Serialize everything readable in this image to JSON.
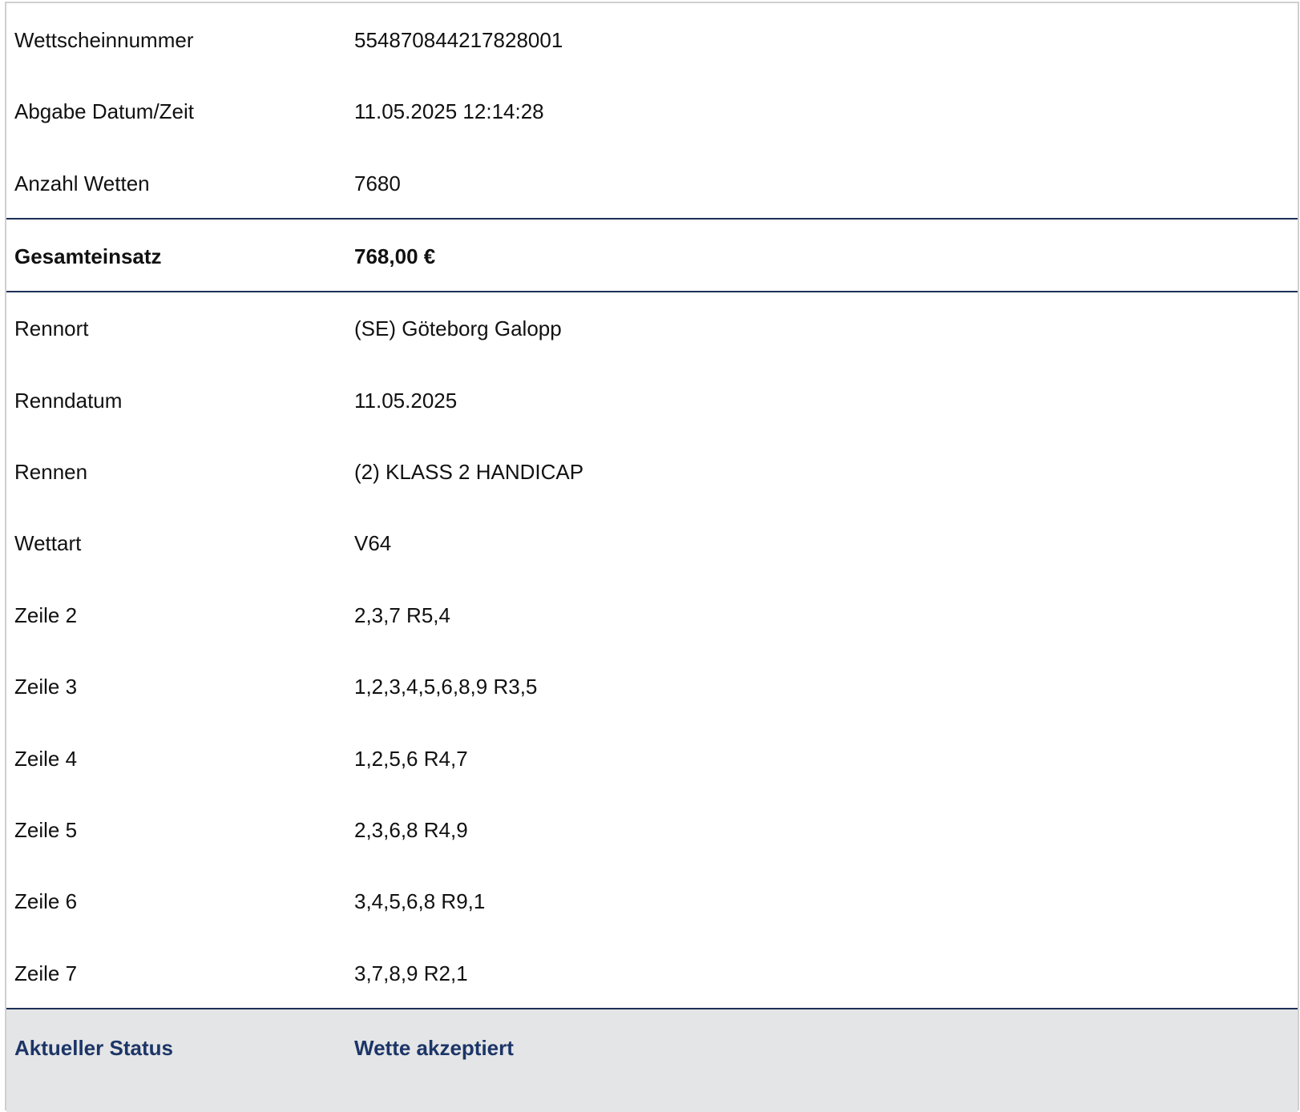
{
  "summary": {
    "ticket_number_label": "Wettscheinnummer",
    "ticket_number_value": "554870844217828001",
    "submitted_label": "Abgabe Datum/Zeit",
    "submitted_value": "11.05.2025 12:14:28",
    "bet_count_label": "Anzahl Wetten",
    "bet_count_value": "7680"
  },
  "total": {
    "label": "Gesamteinsatz",
    "value": "768,00 €"
  },
  "details": {
    "venue_label": "Rennort",
    "venue_value": "(SE) Göteborg Galopp",
    "race_date_label": "Renndatum",
    "race_date_value": "11.05.2025",
    "race_label": "Rennen",
    "race_value": "(2) KLASS 2 HANDICAP",
    "bet_type_label": "Wettart",
    "bet_type_value": "V64",
    "lines": [
      {
        "label": "Zeile 2",
        "value": "2,3,7 R5,4"
      },
      {
        "label": "Zeile 3",
        "value": "1,2,3,4,5,6,8,9 R3,5"
      },
      {
        "label": "Zeile 4",
        "value": "1,2,5,6 R4,7"
      },
      {
        "label": "Zeile 5",
        "value": "2,3,6,8 R4,9"
      },
      {
        "label": "Zeile 6",
        "value": "3,4,5,6,8 R9,1"
      },
      {
        "label": "Zeile 7",
        "value": "3,7,8,9 R2,1"
      }
    ]
  },
  "status": {
    "label": "Aktueller Status",
    "value": "Wette akzeptiert"
  },
  "colors": {
    "rule": "#1d2f57",
    "status_text": "#1c3567",
    "status_background": "#e4e5e6",
    "outer_border": "#cfcfcf"
  }
}
